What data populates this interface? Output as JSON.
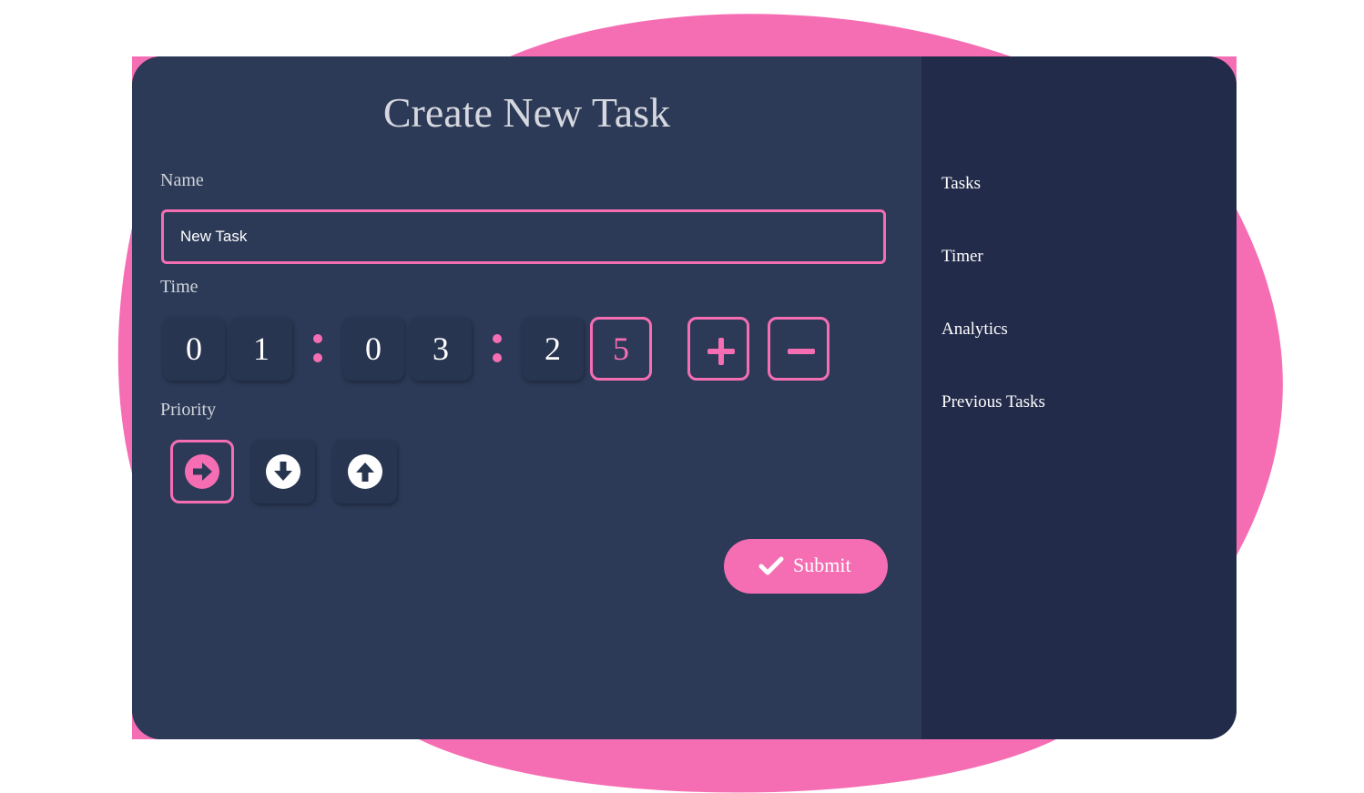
{
  "page": {
    "title": "Create New Task"
  },
  "form": {
    "name_label": "Name",
    "name_value": "New Task",
    "time_label": "Time",
    "time_digits": [
      "0",
      "1",
      "0",
      "3",
      "2",
      "5"
    ],
    "selected_digit_index": 5,
    "priority_label": "Priority",
    "priority_options": [
      {
        "icon": "arrow-right-circle-icon",
        "selected": true
      },
      {
        "icon": "arrow-down-circle-icon",
        "selected": false
      },
      {
        "icon": "arrow-up-circle-icon",
        "selected": false
      }
    ],
    "submit_label": "Submit"
  },
  "sidebar": {
    "items": [
      {
        "label": "Tasks"
      },
      {
        "label": "Timer"
      },
      {
        "label": "Analytics"
      },
      {
        "label": "Previous Tasks"
      }
    ]
  },
  "colors": {
    "accent": "#f56eb3",
    "panel": "#2c3a57",
    "sidebar": "#222b4a",
    "text": "#ffffff"
  }
}
